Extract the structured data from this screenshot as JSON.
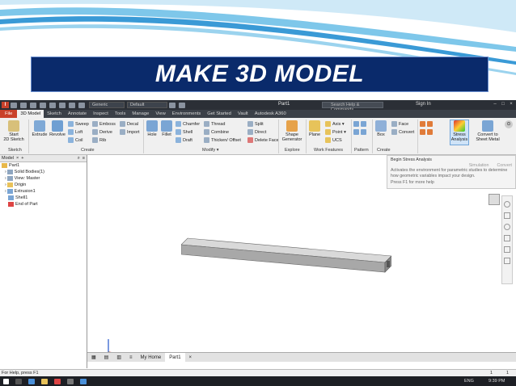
{
  "banner": {
    "title": "MAKE 3D MODEL"
  },
  "app": {
    "qat": {
      "material": "Generic",
      "appearance": "Default",
      "doc_title": "Part1",
      "search_placeholder": "Search Help & Commands...",
      "sign_in": "Sign In"
    },
    "tabs": [
      "File",
      "3D Model",
      "Sketch",
      "Annotate",
      "Inspect",
      "Tools",
      "Manage",
      "View",
      "Environments",
      "Get Started",
      "Vault",
      "Autodesk A360"
    ],
    "active_tab": "3D Model",
    "ribbon": {
      "sketch": {
        "start": "Start",
        "start2": "2D Sketch",
        "label": "Sketch"
      },
      "create": {
        "extrude": "Extrude",
        "revolve": "Revolve",
        "sweep": "Sweep",
        "loft": "Loft",
        "coil": "Coil",
        "emboss": "Emboss",
        "derive": "Derive",
        "rib": "Rib",
        "decal": "Decal",
        "import": "Import",
        "label": "Create"
      },
      "modify": {
        "hole": "Hole",
        "fillet": "Fillet",
        "chamfer": "Chamfer",
        "shell": "Shell",
        "draft": "Draft",
        "thread": "Thread",
        "combine": "Combine",
        "thicken": "Thicken/ Offset",
        "split": "Split",
        "direct": "Direct",
        "delete_face": "Delete Face",
        "label": "Modify ▾"
      },
      "explore": {
        "shape": "Shape",
        "generator": "Generator",
        "label": "Explore"
      },
      "work": {
        "plane": "Plane",
        "axis": "Axis ▾",
        "point": "Point ▾",
        "ucs": "UCS",
        "label": "Work Features"
      },
      "pattern": {
        "label": "Pattern"
      },
      "create_freeform": {
        "box": "Box",
        "label": "Create"
      },
      "surface": {
        "face": "Face",
        "convert": "Convert"
      },
      "stress": {
        "stress": "Stress",
        "analysis": "Analysis"
      },
      "convert": {
        "convert": "Convert to",
        "sheet": "Sheet Metal"
      },
      "simulation": {
        "label1": "Simulation",
        "label2": "Convert"
      }
    },
    "tooltip": {
      "title": "Begin Stress Analysis",
      "body": "Activates the environment for parametric studies to determine how geometric variables impact your design.",
      "help": "Press F1 for more help"
    },
    "browser": {
      "tab": "Model",
      "items": [
        "Part1",
        "Solid Bodies(1)",
        "View: Master",
        "Origin",
        "Extrusion1",
        "Shell1",
        "End of Part"
      ]
    },
    "doc_tabs": {
      "home": "My Home",
      "part": "Part1"
    },
    "status": {
      "text": "For Help, press F1",
      "n1": "1",
      "n2": "1"
    },
    "taskbar": {
      "lang": "ENG",
      "time": "9:39 PM"
    }
  }
}
